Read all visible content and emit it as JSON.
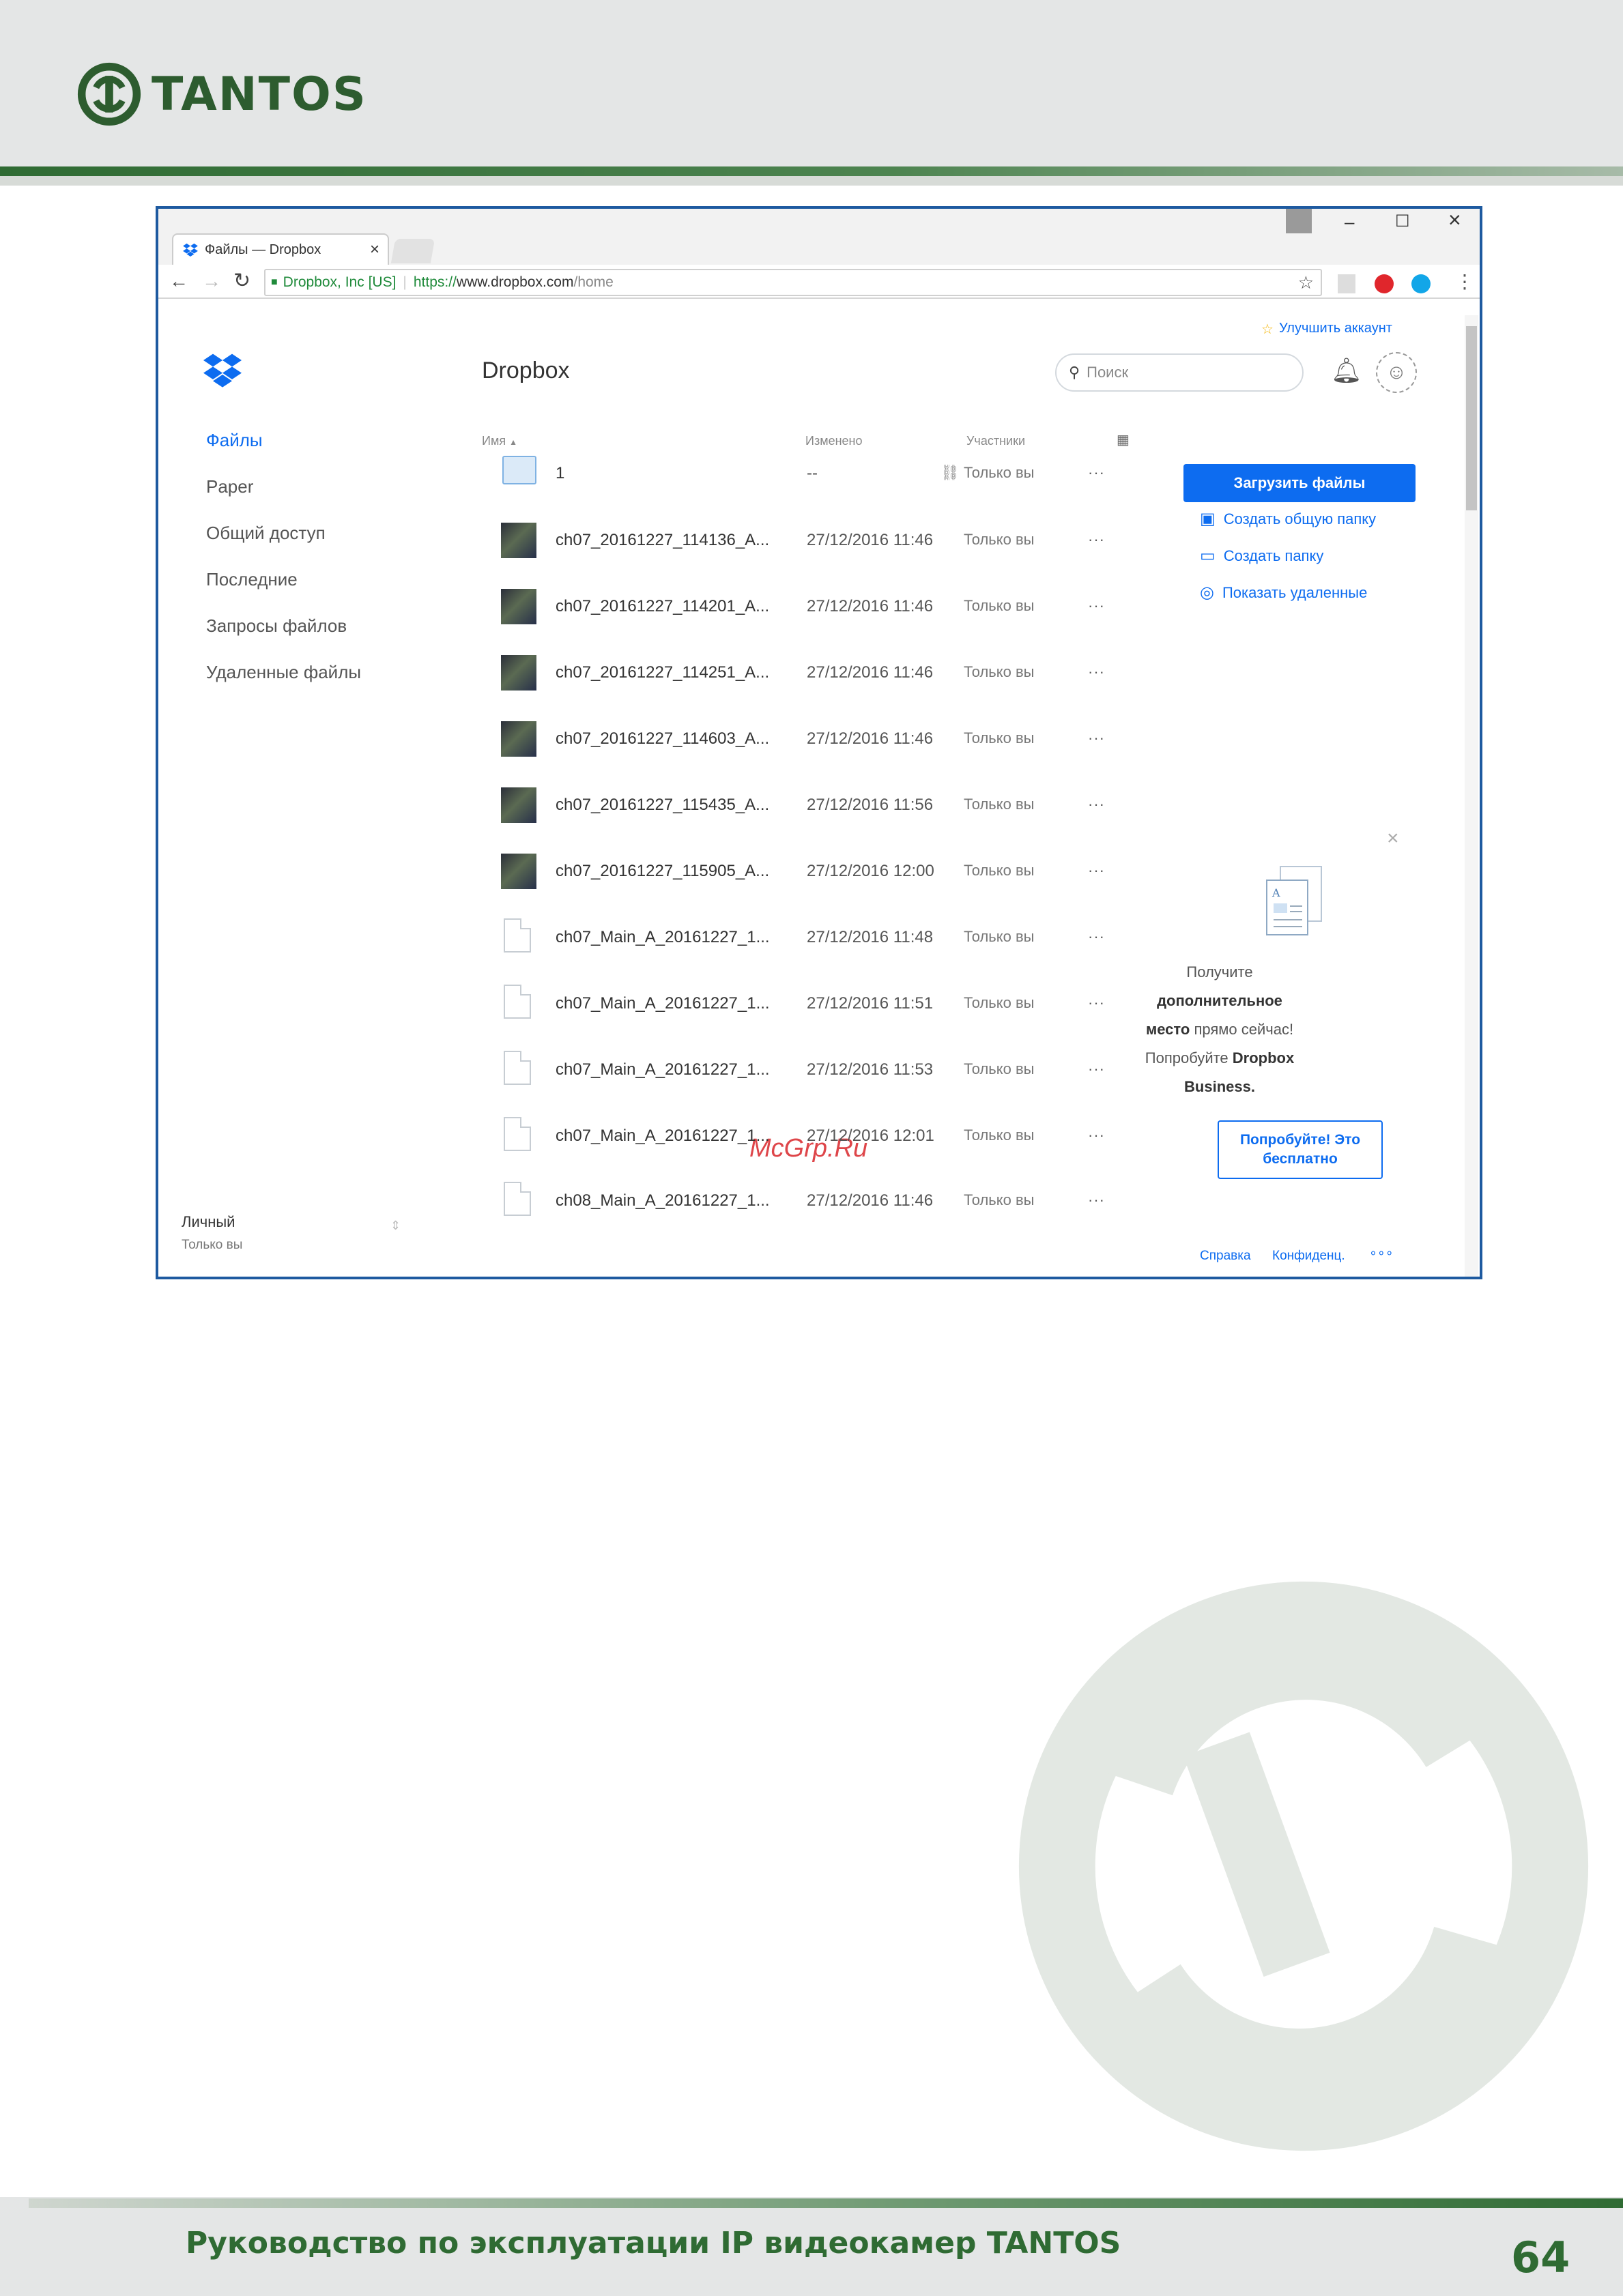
{
  "page": {
    "brand": "TANTOS",
    "footer_title": "Руководство по эксплуатации IP видеокамер TANTOS",
    "page_number": "64",
    "watermark_text": "McGrp.Ru"
  },
  "browser": {
    "tab_title": "Файлы — Dropbox",
    "tab_close": "×",
    "secure_label": "Dropbox, Inc [US]",
    "url_scheme": "https://",
    "url_host": "www.dropbox.com",
    "url_path": "/home",
    "win_minimize": "–",
    "win_maximize": "☐",
    "win_close": "×"
  },
  "dropbox": {
    "upgrade": "Улучшить аккаунт",
    "title": "Dropbox",
    "search_placeholder": "Поиск",
    "nav": [
      {
        "label": "Файлы"
      },
      {
        "label": "Paper"
      },
      {
        "label": "Общий доступ"
      },
      {
        "label": "Последние"
      },
      {
        "label": "Запросы файлов"
      },
      {
        "label": "Удаленные файлы"
      }
    ],
    "account": {
      "name": "Личный",
      "sub": "Только вы"
    },
    "columns": {
      "name": "Имя",
      "modified": "Изменено",
      "members": "Участники"
    },
    "files": [
      {
        "name": "1",
        "modified": "--",
        "members": "Только вы",
        "more": "···"
      },
      {
        "name": "ch07_20161227_114136_A...",
        "modified": "27/12/2016 11:46",
        "members": "Только вы",
        "more": "···"
      },
      {
        "name": "ch07_20161227_114201_A...",
        "modified": "27/12/2016 11:46",
        "members": "Только вы",
        "more": "···"
      },
      {
        "name": "ch07_20161227_114251_A...",
        "modified": "27/12/2016 11:46",
        "members": "Только вы",
        "more": "···"
      },
      {
        "name": "ch07_20161227_114603_A...",
        "modified": "27/12/2016 11:46",
        "members": "Только вы",
        "more": "···"
      },
      {
        "name": "ch07_20161227_115435_A...",
        "modified": "27/12/2016 11:56",
        "members": "Только вы",
        "more": "···"
      },
      {
        "name": "ch07_20161227_115905_A...",
        "modified": "27/12/2016 12:00",
        "members": "Только вы",
        "more": "···"
      },
      {
        "name": "ch07_Main_A_20161227_1...",
        "modified": "27/12/2016 11:48",
        "members": "Только вы",
        "more": "···"
      },
      {
        "name": "ch07_Main_A_20161227_1...",
        "modified": "27/12/2016 11:51",
        "members": "Только вы",
        "more": "···"
      },
      {
        "name": "ch07_Main_A_20161227_1...",
        "modified": "27/12/2016 11:53",
        "members": "Только вы",
        "more": "···"
      },
      {
        "name": "ch07_Main_A_20161227_1...",
        "modified": "27/12/2016 12:01",
        "members": "Только вы",
        "more": "···"
      },
      {
        "name": "ch08_Main_A_20161227_1...",
        "modified": "27/12/2016 11:46",
        "members": "Только вы",
        "more": "···"
      }
    ],
    "upload_button": "Загрузить файлы",
    "actions": [
      {
        "label": "Создать общую папку"
      },
      {
        "label": "Создать папку"
      },
      {
        "label": "Показать удаленные"
      }
    ],
    "promo": {
      "line1": "Получите",
      "line2": "дополнительное",
      "line3_bold": "место",
      "line3_rest": " прямо сейчас!",
      "line4": "Попробуйте ",
      "line4_bold": "Dropbox",
      "line5": "Business.",
      "cta": "Попробуйте! Это бесплатно",
      "close": "×"
    },
    "footer_links": {
      "help": "Справка",
      "privacy": "Конфиденц.",
      "more": "∘∘∘"
    }
  }
}
